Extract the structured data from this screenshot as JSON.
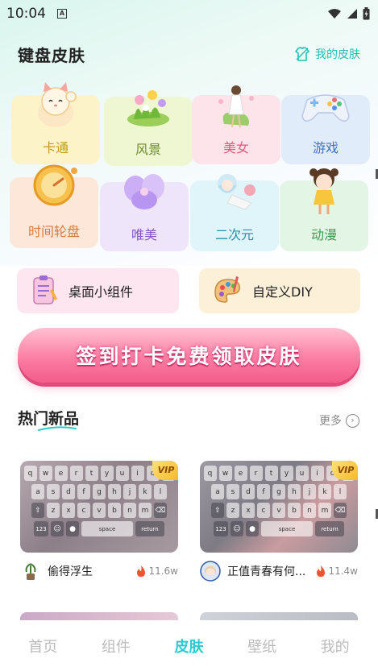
{
  "status_bar": {
    "time": "10:04",
    "sim_label": "A"
  },
  "header": {
    "title": "键盘皮肤",
    "my_skin_label": "我的皮肤"
  },
  "categories": [
    {
      "label": "卡通",
      "bg": "#fdf3c8",
      "color": "#c49a1d",
      "icon": "lucky-cat-icon"
    },
    {
      "label": "风景",
      "bg": "#eef7d2",
      "color": "#6e8c2a",
      "icon": "flower-bush-icon"
    },
    {
      "label": "美女",
      "bg": "#fde3ea",
      "color": "#e25a7e",
      "icon": "girl-figure-icon"
    },
    {
      "label": "游戏",
      "bg": "#e1ecfb",
      "color": "#3d73c9",
      "icon": "gamepad-icon"
    },
    {
      "label": "时间轮盘",
      "bg": "#fde7d8",
      "color": "#d97a3c",
      "icon": "time-wheel-icon"
    },
    {
      "label": "唯美",
      "bg": "#efe5fb",
      "color": "#8456c9",
      "icon": "purple-flower-icon"
    },
    {
      "label": "二次元",
      "bg": "#dff5fa",
      "color": "#2a8fa8",
      "icon": "anime-girl-icon"
    },
    {
      "label": "动漫",
      "bg": "#e3f6e6",
      "color": "#3e9a55",
      "icon": "cartoon-doll-icon"
    }
  ],
  "shortcuts": [
    {
      "label": "桌面小组件",
      "bg": "#fde6ef",
      "icon": "widget-clipboard-icon"
    },
    {
      "label": "自定义DIY",
      "bg": "#fdf0d8",
      "icon": "paint-palette-icon"
    }
  ],
  "sign_in": {
    "label": "签到打卡免费领取皮肤"
  },
  "hot": {
    "title": "热门新品",
    "more_label": "更多"
  },
  "keyboard": {
    "row1": [
      "q",
      "w",
      "e",
      "r",
      "t",
      "y",
      "u",
      "i",
      "o",
      "p"
    ],
    "row2": [
      "a",
      "s",
      "d",
      "f",
      "g",
      "h",
      "j",
      "k",
      "l"
    ],
    "row3": [
      "z",
      "x",
      "c",
      "v",
      "b",
      "n",
      "m"
    ],
    "num_key": "123",
    "space_key": "space",
    "return_key": "return",
    "vip_label": "VIP"
  },
  "cards": [
    {
      "name": "偷得浮生",
      "hot_count": "11.6w",
      "avatar_icon": "plant-avatar-icon",
      "tint": "#9a8a92"
    },
    {
      "name": "正值青春有何...",
      "hot_count": "11.4w",
      "avatar_icon": "girl-avatar-icon",
      "tint": "#8e8c93"
    }
  ],
  "nav": [
    {
      "label": "首页",
      "active": false
    },
    {
      "label": "组件",
      "active": false
    },
    {
      "label": "皮肤",
      "active": true
    },
    {
      "label": "壁纸",
      "active": false
    },
    {
      "label": "我的",
      "active": false
    }
  ],
  "colors": {
    "accent": "#2ccad0",
    "sign_in_pink": "#f56a95",
    "hot_flame": "#f0532f"
  }
}
